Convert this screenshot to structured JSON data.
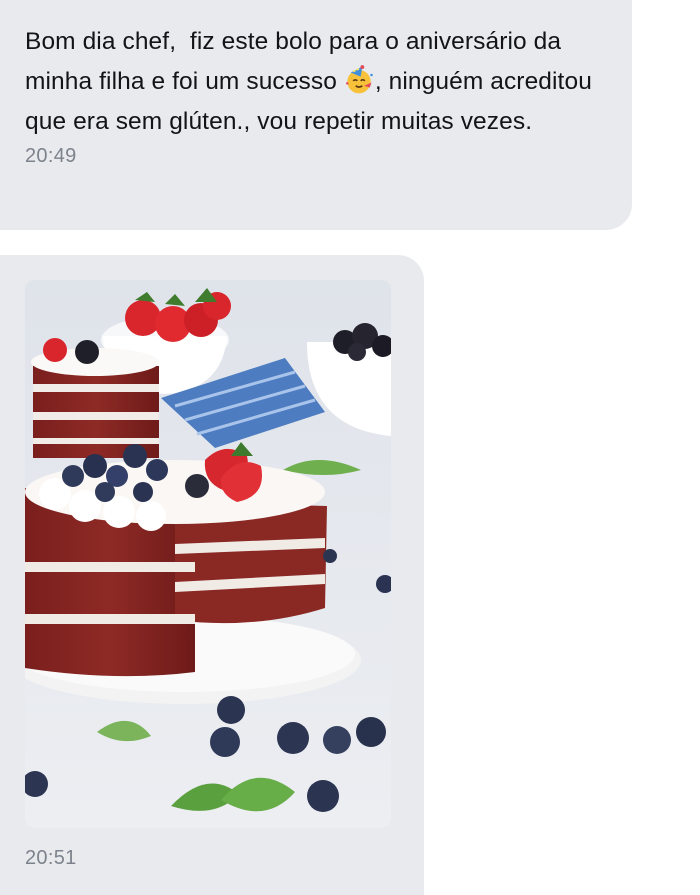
{
  "messages": [
    {
      "text_before_emoji": "Bom dia chef,  fiz este bolo para o aniversário da minha filha e foi um sucesso ",
      "emoji": "face-with-party-hat-emoji",
      "text_after_emoji": ", ninguém acreditou que era sem glúten., vou repetir muitas vezes.",
      "time": "20:49"
    },
    {
      "image": "red-velvet-cake-photo",
      "time": "20:51"
    }
  ],
  "colors": {
    "bubble": "#e8eaee",
    "text": "#111418",
    "timestamp": "#7d838c"
  }
}
